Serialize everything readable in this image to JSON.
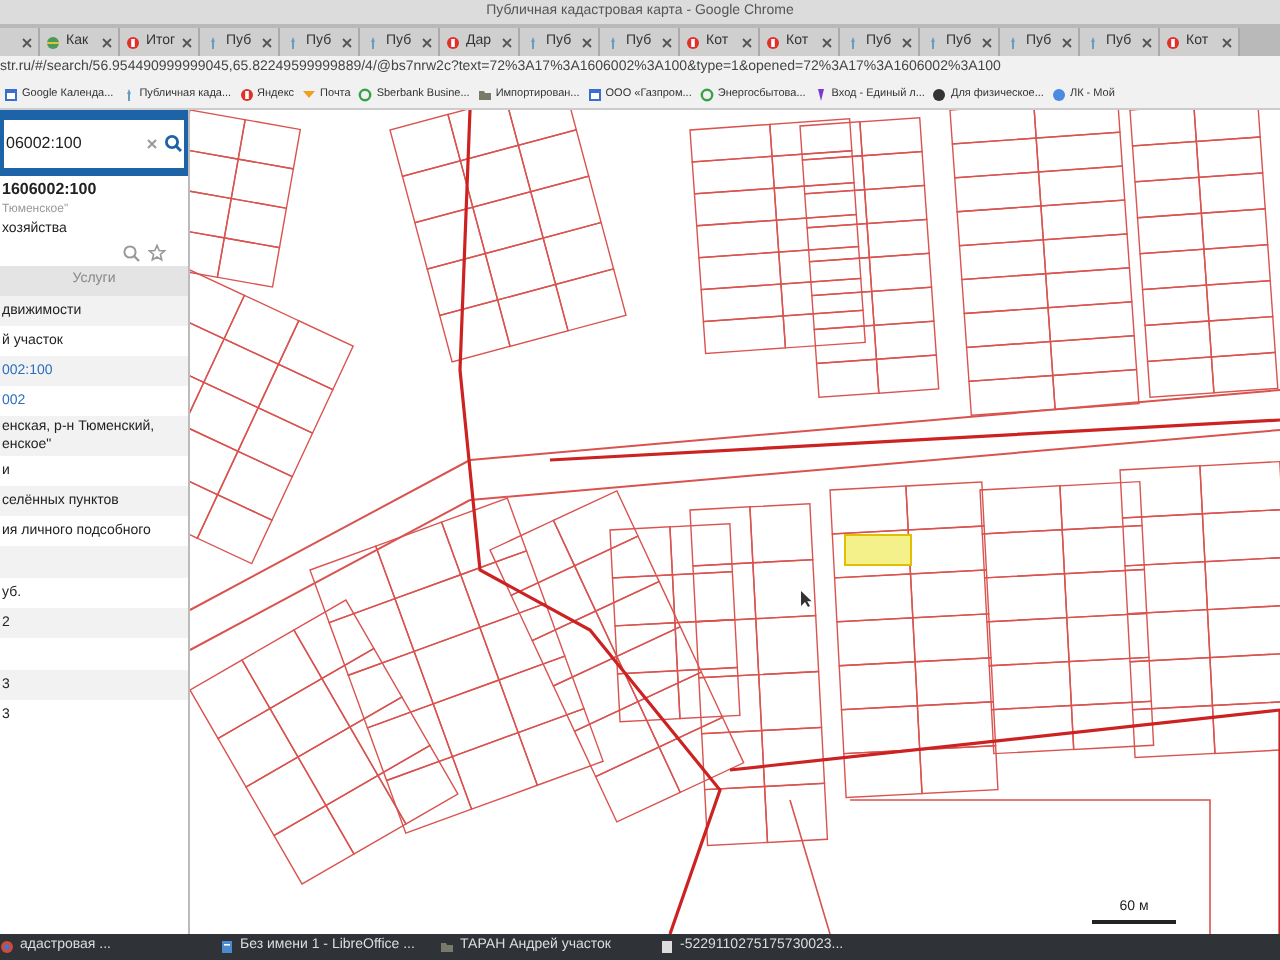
{
  "window": {
    "title": "Публичная кадастровая карта - Google Chrome"
  },
  "tabs": [
    {
      "kind": "partial"
    },
    {
      "label": "Как",
      "kind": "globe"
    },
    {
      "label": "Итог",
      "kind": "red"
    },
    {
      "label": "Пуб",
      "kind": "pin"
    },
    {
      "label": "Пуб",
      "kind": "pin"
    },
    {
      "label": "Пуб",
      "kind": "pin"
    },
    {
      "label": "Дар",
      "kind": "red"
    },
    {
      "label": "Пуб",
      "kind": "pin"
    },
    {
      "label": "Пуб",
      "kind": "pin"
    },
    {
      "label": "Кот",
      "kind": "red"
    },
    {
      "label": "Кот",
      "kind": "red"
    },
    {
      "label": "Пуб",
      "kind": "pin"
    },
    {
      "label": "Пуб",
      "kind": "pin"
    },
    {
      "label": "Пуб",
      "kind": "pin"
    },
    {
      "label": "Пуб",
      "kind": "pin"
    },
    {
      "label": "Кот",
      "kind": "red"
    }
  ],
  "address": "str.ru/#/search/56.954490999999045,65.82249599999889/4/@bs7nrw2c?text=72%3A17%3A1606002%3A100&type=1&opened=72%3A17%3A1606002%3A100",
  "bookmarks": [
    {
      "label": "Google Календа...",
      "kind": "calendar"
    },
    {
      "label": "Публичная када...",
      "kind": "pin"
    },
    {
      "label": "Яндекс",
      "kind": "red"
    },
    {
      "label": "Почта",
      "kind": "mail"
    },
    {
      "label": "Sberbank Busine...",
      "kind": "ring"
    },
    {
      "label": "Импортирован...",
      "kind": "folder"
    },
    {
      "label": "ООО «Газпром...",
      "kind": "calendar"
    },
    {
      "label": "Энергосбытова...",
      "kind": "ring"
    },
    {
      "label": "Вход - Единый л...",
      "kind": "purple"
    },
    {
      "label": "Для физическое...",
      "kind": "dark"
    },
    {
      "label": "ЛК - Мой",
      "kind": "blue"
    }
  ],
  "panel": {
    "search": "06002:100",
    "title": "1606002:100",
    "subtitle": "Тюменское\"",
    "type": "хозяйства",
    "services": "Услуги",
    "rows": [
      {
        "kind": "text",
        "lines": [
          "движимости"
        ]
      },
      {
        "kind": "text",
        "lines": [
          "й участок"
        ]
      },
      {
        "kind": "link",
        "lines": [
          "002:100"
        ]
      },
      {
        "kind": "link",
        "lines": [
          "002"
        ]
      },
      {
        "kind": "text",
        "lines": [
          "енская, р-н Тюменский,",
          "енское\""
        ]
      },
      {
        "kind": "text",
        "lines": [
          "и"
        ]
      },
      {
        "kind": "text",
        "lines": [
          "селённых пунктов"
        ]
      },
      {
        "kind": "text",
        "lines": [
          "ия личного подсобного"
        ]
      },
      {
        "kind": "blank"
      },
      {
        "kind": "text",
        "lines": [
          "уб."
        ]
      },
      {
        "kind": "text",
        "lines": [
          "2"
        ]
      },
      {
        "kind": "blank"
      },
      {
        "kind": "text",
        "lines": [
          "3"
        ]
      },
      {
        "kind": "text",
        "lines": [
          "3"
        ]
      }
    ]
  },
  "map": {
    "scale": "60 м"
  },
  "taskbar": [
    {
      "label": "адастровая ...",
      "kind": "chrome"
    },
    {
      "label": "Без имени 1 - LibreOffice ...",
      "kind": "doc"
    },
    {
      "label": "ТАРАН Андрей участок",
      "kind": "folder"
    },
    {
      "label": "-5229110275175730023...",
      "kind": "file"
    }
  ]
}
